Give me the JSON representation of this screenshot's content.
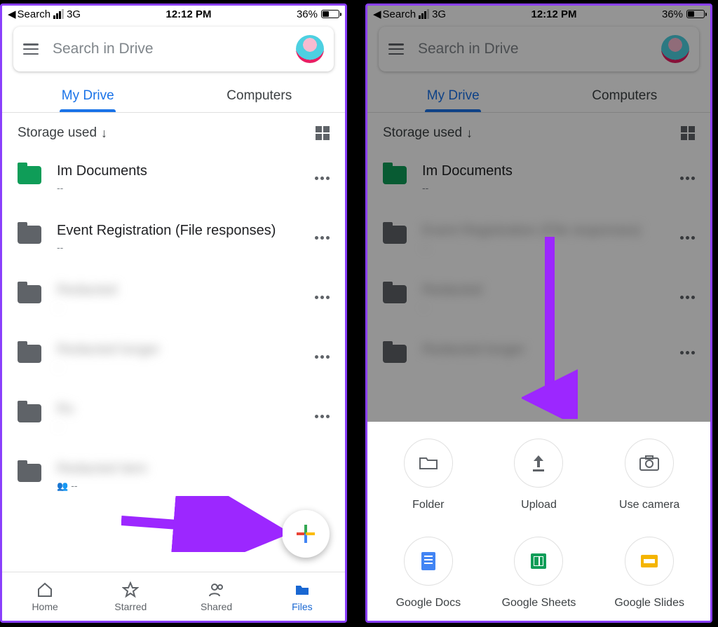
{
  "statusbar": {
    "back_app": "Search",
    "network": "3G",
    "time": "12:12 PM",
    "battery_pct": "36%"
  },
  "search": {
    "placeholder": "Search in Drive"
  },
  "tabs": {
    "my_drive": "My Drive",
    "computers": "Computers"
  },
  "sort": {
    "label": "Storage used"
  },
  "files": [
    {
      "name": "Im Documents",
      "meta": "--",
      "color": "green",
      "blurred": false,
      "shared": false
    },
    {
      "name": "Event Registration (File responses)",
      "meta": "--",
      "color": "grey",
      "blurred": false,
      "shared": false
    },
    {
      "name": "Redacted",
      "meta": "-",
      "color": "grey",
      "blurred": true,
      "shared": false
    },
    {
      "name": "Redacted longer",
      "meta": "-",
      "color": "grey",
      "blurred": true,
      "shared": false
    },
    {
      "name": "Rx",
      "meta": "-",
      "color": "grey",
      "blurred": true,
      "shared": false
    },
    {
      "name": "Redacted item",
      "meta": "",
      "color": "grey",
      "blurred": true,
      "shared": true
    }
  ],
  "bottomnav": {
    "home": "Home",
    "starred": "Starred",
    "shared": "Shared",
    "files": "Files"
  },
  "sheet": {
    "items": [
      {
        "label": "Folder",
        "icon": "folder"
      },
      {
        "label": "Upload",
        "icon": "upload"
      },
      {
        "label": "Use camera",
        "icon": "camera"
      },
      {
        "label": "Google Docs",
        "icon": "docs"
      },
      {
        "label": "Google Sheets",
        "icon": "sheets"
      },
      {
        "label": "Google Slides",
        "icon": "slides"
      }
    ]
  }
}
